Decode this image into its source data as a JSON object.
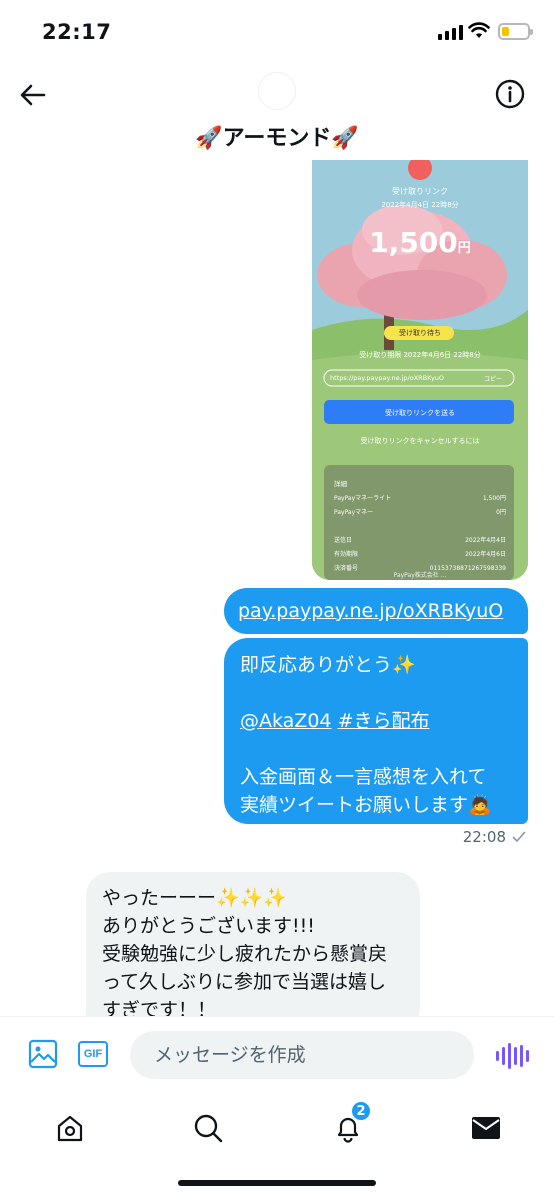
{
  "status_bar": {
    "time": "22:17"
  },
  "header": {
    "title": "🚀アーモンド🚀"
  },
  "image_message": {
    "label": "受け取りリンク",
    "date": "2022年4月4日 22時8分",
    "amount": "1,500",
    "currency": "円",
    "status_badge": "受け取り待ち",
    "expiry": "受け取り期限 2022年4月6日 22時8分",
    "link": "https://pay.paypay.ne.jp/oXRBKyuO",
    "copy_label": "コピー",
    "send_button": "受け取りリンクを送る",
    "cancel_link": "受け取りリンクをキャンセルするには",
    "details_title": "詳細",
    "details": [
      {
        "label": "PayPayマネーライト",
        "value": "1,500円"
      },
      {
        "label": "PayPayマネー",
        "value": "0円"
      }
    ],
    "details2": [
      {
        "label": "送信日",
        "value": "2022年4月4日"
      },
      {
        "label": "有効期限",
        "value": "2022年4月6日"
      },
      {
        "label": "決済番号",
        "value": "01153738871267598339"
      }
    ],
    "footer": "PayPay株式会社 ..."
  },
  "messages": {
    "link_text": "pay.paypay.ne.jp/oXRBKyuO",
    "out_line1": "即反応ありがとう✨",
    "out_mention": "@AkaZ04",
    "out_hashtag": "#きら配布",
    "out_line3": "入金画面＆一言感想を入れて",
    "out_line4": "実績ツイートお願いします🙇",
    "sent_time": "22:08",
    "in_text": "やったーーー✨✨✨\nありがとうございます!!!\n受験勉強に少し疲れたから懸賞戻って久しぶりに参加で当選は嬉しすぎです！！"
  },
  "composer": {
    "placeholder": "メッセージを作成"
  },
  "nav": {
    "notifications_badge": "2"
  },
  "colors": {
    "accent": "#1d9bf0",
    "voice": "#7856ff"
  }
}
